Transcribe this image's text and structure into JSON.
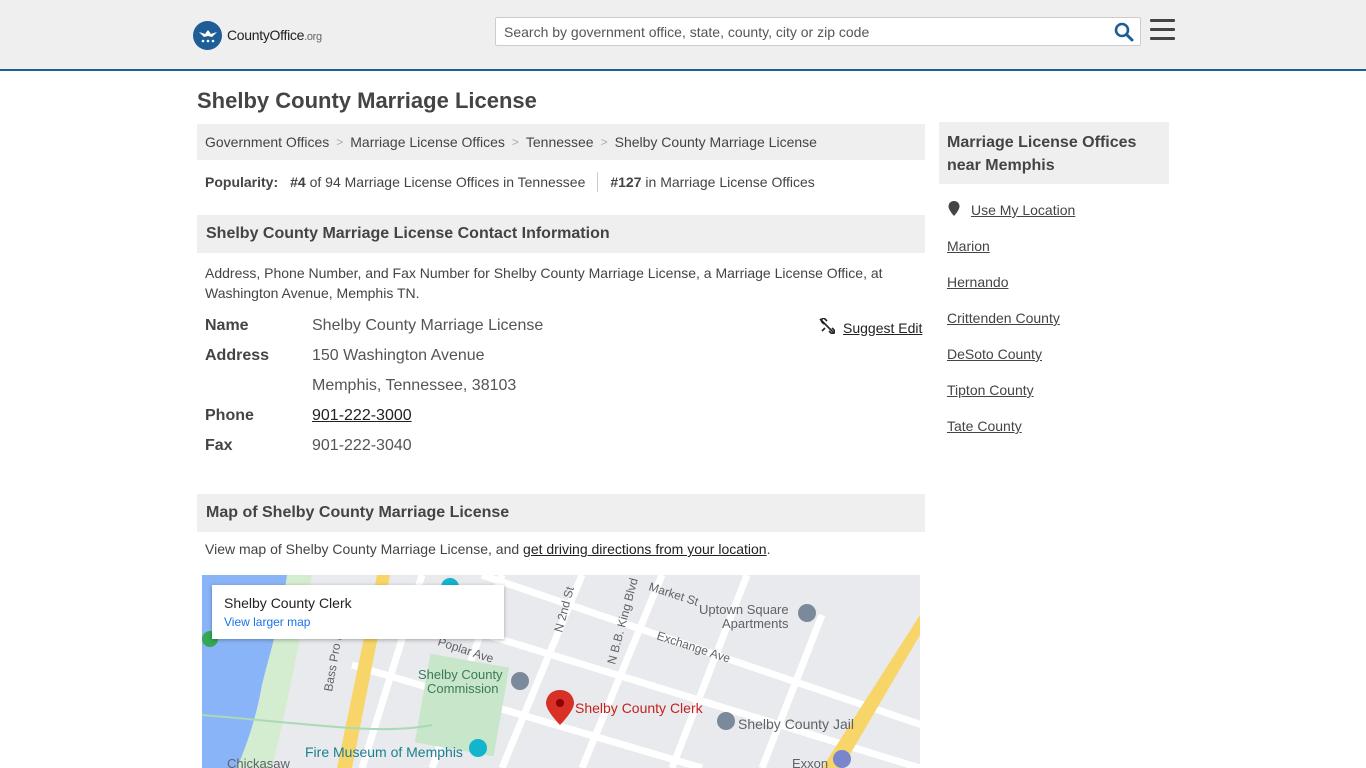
{
  "header": {
    "logo_brand": "CountyOffice",
    "logo_tld": ".org",
    "search_placeholder": "Search by government office, state, county, city or zip code"
  },
  "page_title": "Shelby County Marriage License",
  "breadcrumb": [
    "Government Offices",
    "Marriage License Offices",
    "Tennessee",
    "Shelby County Marriage License"
  ],
  "popularity": {
    "label": "Popularity:",
    "rank_state": "#4",
    "rank_state_text": "of 94 Marriage License Offices in Tennessee",
    "rank_national": "#127",
    "rank_national_text": "in Marriage License Offices"
  },
  "contact": {
    "heading": "Shelby County Marriage License Contact Information",
    "description": "Address, Phone Number, and Fax Number for Shelby County Marriage License, a Marriage License Office, at Washington Avenue, Memphis TN.",
    "suggest_edit": "Suggest Edit",
    "name_label": "Name",
    "name": "Shelby County Marriage License",
    "address_label": "Address",
    "address_line1": "150 Washington Avenue",
    "address_line2": "Memphis, Tennessee, 38103",
    "phone_label": "Phone",
    "phone": "901-222-3000",
    "fax_label": "Fax",
    "fax": "901-222-3040"
  },
  "map_section": {
    "heading": "Map of Shelby County Marriage License",
    "desc_prefix": "View map of Shelby County Marriage License, and ",
    "desc_link": "get driving directions from your location",
    "desc_suffix": ".",
    "card_title": "Shelby County Clerk",
    "card_link": "View larger map",
    "labels": {
      "market_st": "Market St",
      "n2nd": "N 2nd St",
      "bbking": "N B.B. King Blvd",
      "exchange": "Exchange Ave",
      "uptown1": "Uptown Square",
      "uptown2": "Apartments",
      "poplar": "Poplar Ave",
      "bass_pro": "Bass Pro L",
      "commission1": "Shelby County",
      "commission2": "Commission",
      "clerk": "Shelby County Clerk",
      "jail": "Shelby County Jail",
      "fire_museum": "Fire Museum of Memphis",
      "chickasaw": "Chickasaw",
      "exxon": "Exxon"
    }
  },
  "sidebar": {
    "heading": "Marriage License Offices near Memphis",
    "use_location": "Use My Location",
    "items": [
      "Marion",
      "Hernando",
      "Crittenden County",
      "DeSoto County",
      "Tipton County",
      "Tate County"
    ]
  },
  "colors": {
    "brand_blue": "#1f5d98",
    "header_bg": "#efefef",
    "map_pin": "#d93025"
  }
}
